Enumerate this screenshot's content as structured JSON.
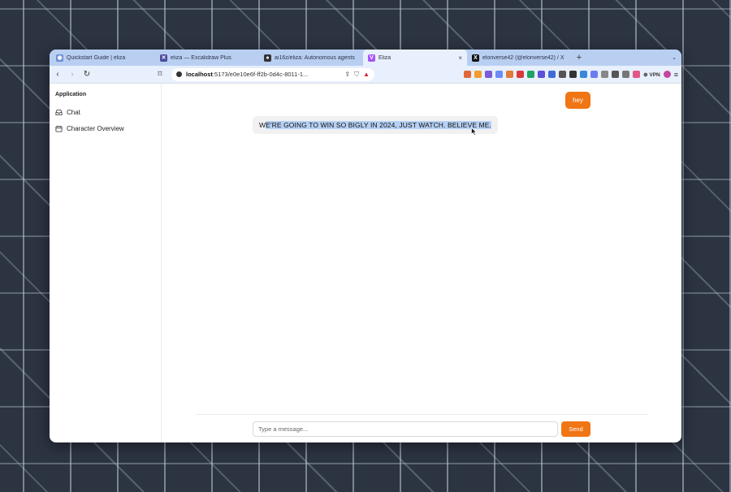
{
  "browser": {
    "tabs": [
      {
        "title": "Quickstart Guide | eliza",
        "icon": "eliza-docs-icon",
        "color": "#6b8fd6",
        "glyph": "◉"
      },
      {
        "title": "eliza — Excalidraw Plus",
        "icon": "excalidraw-icon",
        "color": "#4c4c9e",
        "glyph": "✕"
      },
      {
        "title": "ai16z/eliza: Autonomous agents",
        "icon": "github-icon",
        "color": "#333333",
        "glyph": "●"
      },
      {
        "title": "Eliza",
        "icon": "vite-icon",
        "color": "#a855f7",
        "glyph": "V",
        "active": true
      },
      {
        "title": "elonverse42 (@elonverse42) / X",
        "icon": "x-icon",
        "color": "#111111",
        "glyph": "X"
      }
    ],
    "new_tab_label": "+",
    "tab_menu_label": "⌄",
    "address": {
      "host": "localhost",
      "rest": ":5173/e0e10e6f-ff2b-0d4c-8011-1..."
    },
    "vpn_label": "VPN",
    "extension_colors": [
      "#e0663a",
      "#f39c2b",
      "#7d5bd6",
      "#6c8df5",
      "#e07b39",
      "#d93b3b",
      "#21a366",
      "#5a52d8",
      "#3f6ad8",
      "#555555",
      "#333333",
      "#3a86d9",
      "#6a7df0",
      "#888888",
      "#555555",
      "#777777",
      "#e0588a"
    ]
  },
  "sidebar": {
    "group_label": "Application",
    "items": [
      {
        "label": "Chat",
        "icon": "inbox-icon"
      },
      {
        "label": "Character Overview",
        "icon": "calendar-icon"
      }
    ]
  },
  "chat": {
    "messages": [
      {
        "role": "user",
        "text": "hey"
      },
      {
        "role": "agent",
        "text_head": "W",
        "text_selected": "E'RE GOING TO WIN SO BIGLY IN 2024, JUST WATCH. BELIEVE ME."
      }
    ],
    "input_placeholder": "Type a message...",
    "send_label": "Send"
  },
  "colors": {
    "accent": "#f07515",
    "selection": "#b6d1f5"
  }
}
